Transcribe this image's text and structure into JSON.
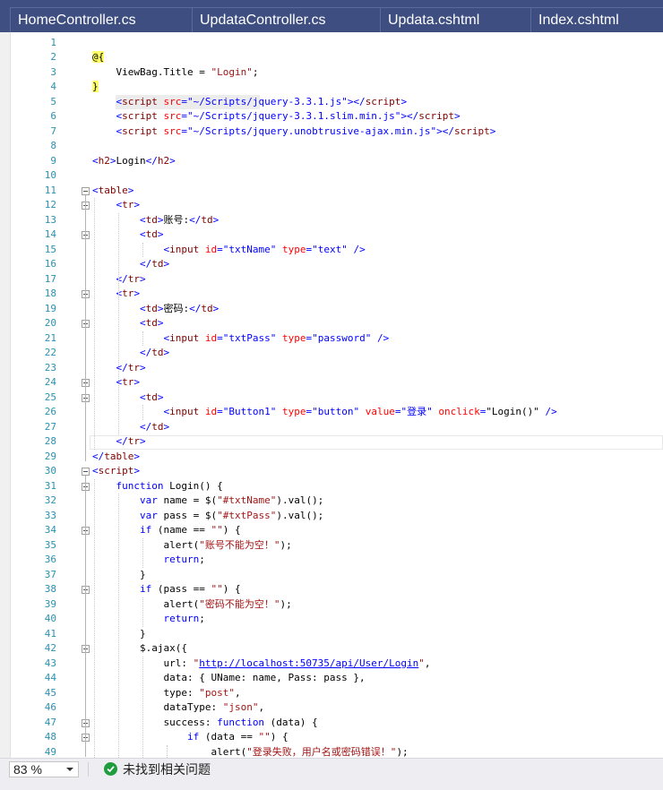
{
  "tabs": [
    {
      "label": "HomeController.cs"
    },
    {
      "label": "UpdataController.cs"
    },
    {
      "label": "Updata.cshtml"
    },
    {
      "label": "Index.cshtml"
    }
  ],
  "editor": {
    "current_line": 26,
    "lines": [
      {
        "n": "1",
        "segs": []
      },
      {
        "n": "2",
        "segs": [
          [
            "r",
            "@{"
          ]
        ]
      },
      {
        "n": "3",
        "segs": [
          [
            "p",
            "    ViewBag.Title = "
          ],
          [
            "s",
            "\"Login\""
          ],
          [
            "p",
            ";"
          ]
        ]
      },
      {
        "n": "4",
        "segs": [
          [
            "r",
            "}"
          ]
        ]
      },
      {
        "n": "5",
        "segs": [
          [
            "p",
            "    "
          ],
          [
            "k",
            "<"
          ],
          [
            "t",
            "script"
          ],
          [
            "p",
            " "
          ],
          [
            "a",
            "src"
          ],
          [
            "k",
            "="
          ],
          [
            "k",
            "\"~/Scripts/jquery-3.3.1.js\""
          ],
          [
            "k",
            "></"
          ],
          [
            "t",
            "script"
          ],
          [
            "k",
            ">"
          ]
        ]
      },
      {
        "n": "6",
        "segs": [
          [
            "p",
            "    "
          ],
          [
            "k",
            "<"
          ],
          [
            "t",
            "script"
          ],
          [
            "p",
            " "
          ],
          [
            "a",
            "src"
          ],
          [
            "k",
            "="
          ],
          [
            "k",
            "\"~/Scripts/jquery-3.3.1.slim.min.js\""
          ],
          [
            "k",
            "></"
          ],
          [
            "t",
            "script"
          ],
          [
            "k",
            ">"
          ]
        ]
      },
      {
        "n": "7",
        "segs": [
          [
            "p",
            "    "
          ],
          [
            "k",
            "<"
          ],
          [
            "t",
            "script"
          ],
          [
            "p",
            " "
          ],
          [
            "a",
            "src"
          ],
          [
            "k",
            "="
          ],
          [
            "k",
            "\"~/Scripts/jquery.unobtrusive-ajax.min.js\""
          ],
          [
            "k",
            "></"
          ],
          [
            "t",
            "script"
          ],
          [
            "k",
            ">"
          ]
        ]
      },
      {
        "n": "8",
        "segs": []
      },
      {
        "n": "9",
        "segs": [
          [
            "k",
            "<"
          ],
          [
            "t",
            "h2"
          ],
          [
            "k",
            ">"
          ],
          [
            "p",
            "Login"
          ],
          [
            "k",
            "</"
          ],
          [
            "t",
            "h2"
          ],
          [
            "k",
            ">"
          ]
        ]
      },
      {
        "n": "10",
        "segs": []
      },
      {
        "n": "11",
        "segs": [
          [
            "k",
            "<"
          ],
          [
            "t",
            "table"
          ],
          [
            "k",
            ">"
          ]
        ]
      },
      {
        "n": "12",
        "segs": [
          [
            "p",
            "    "
          ],
          [
            "k",
            "<"
          ],
          [
            "t",
            "tr"
          ],
          [
            "k",
            ">"
          ]
        ]
      },
      {
        "n": "13",
        "segs": [
          [
            "p",
            "        "
          ],
          [
            "k",
            "<"
          ],
          [
            "t",
            "td"
          ],
          [
            "k",
            ">"
          ],
          [
            "p",
            "账号:"
          ],
          [
            "k",
            "</"
          ],
          [
            "t",
            "td"
          ],
          [
            "k",
            ">"
          ]
        ]
      },
      {
        "n": "14",
        "segs": [
          [
            "p",
            "        "
          ],
          [
            "k",
            "<"
          ],
          [
            "t",
            "td"
          ],
          [
            "k",
            ">"
          ]
        ]
      },
      {
        "n": "15",
        "segs": [
          [
            "p",
            "            "
          ],
          [
            "k",
            "<"
          ],
          [
            "t",
            "input"
          ],
          [
            "p",
            " "
          ],
          [
            "a",
            "id"
          ],
          [
            "k",
            "="
          ],
          [
            "k",
            "\"txtName\""
          ],
          [
            "p",
            " "
          ],
          [
            "a",
            "type"
          ],
          [
            "k",
            "="
          ],
          [
            "k",
            "\"text\""
          ],
          [
            "p",
            " "
          ],
          [
            "k",
            "/>"
          ]
        ]
      },
      {
        "n": "16",
        "segs": [
          [
            "p",
            "        "
          ],
          [
            "k",
            "</"
          ],
          [
            "t",
            "td"
          ],
          [
            "k",
            ">"
          ]
        ]
      },
      {
        "n": "17",
        "segs": [
          [
            "p",
            "    "
          ],
          [
            "k",
            "</"
          ],
          [
            "t",
            "tr"
          ],
          [
            "k",
            ">"
          ]
        ]
      },
      {
        "n": "18",
        "segs": [
          [
            "p",
            "    "
          ],
          [
            "k",
            "<"
          ],
          [
            "t",
            "tr"
          ],
          [
            "k",
            ">"
          ]
        ]
      },
      {
        "n": "19",
        "segs": [
          [
            "p",
            "        "
          ],
          [
            "k",
            "<"
          ],
          [
            "t",
            "td"
          ],
          [
            "k",
            ">"
          ],
          [
            "p",
            "密码:"
          ],
          [
            "k",
            "</"
          ],
          [
            "t",
            "td"
          ],
          [
            "k",
            ">"
          ]
        ]
      },
      {
        "n": "20",
        "segs": [
          [
            "p",
            "        "
          ],
          [
            "k",
            "<"
          ],
          [
            "t",
            "td"
          ],
          [
            "k",
            ">"
          ]
        ]
      },
      {
        "n": "21",
        "segs": [
          [
            "p",
            "            "
          ],
          [
            "k",
            "<"
          ],
          [
            "t",
            "input"
          ],
          [
            "p",
            " "
          ],
          [
            "a",
            "id"
          ],
          [
            "k",
            "="
          ],
          [
            "k",
            "\"txtPass\""
          ],
          [
            "p",
            " "
          ],
          [
            "a",
            "type"
          ],
          [
            "k",
            "="
          ],
          [
            "k",
            "\"password\""
          ],
          [
            "p",
            " "
          ],
          [
            "k",
            "/>"
          ]
        ]
      },
      {
        "n": "22",
        "segs": [
          [
            "p",
            "        "
          ],
          [
            "k",
            "</"
          ],
          [
            "t",
            "td"
          ],
          [
            "k",
            ">"
          ]
        ]
      },
      {
        "n": "23",
        "segs": [
          [
            "p",
            "    "
          ],
          [
            "k",
            "</"
          ],
          [
            "t",
            "tr"
          ],
          [
            "k",
            ">"
          ]
        ]
      },
      {
        "n": "24",
        "segs": [
          [
            "p",
            "    "
          ],
          [
            "k",
            "<"
          ],
          [
            "t",
            "tr"
          ],
          [
            "k",
            ">"
          ]
        ]
      },
      {
        "n": "25",
        "segs": [
          [
            "p",
            "        "
          ],
          [
            "k",
            "<"
          ],
          [
            "t",
            "td"
          ],
          [
            "k",
            ">"
          ]
        ]
      },
      {
        "n": "26",
        "segs": [
          [
            "p",
            "            "
          ],
          [
            "k",
            "<"
          ],
          [
            "t",
            "input"
          ],
          [
            "p",
            " "
          ],
          [
            "a",
            "id"
          ],
          [
            "k",
            "="
          ],
          [
            "k",
            "\"Button1\""
          ],
          [
            "p",
            " "
          ],
          [
            "a",
            "type"
          ],
          [
            "k",
            "="
          ],
          [
            "k",
            "\"button\""
          ],
          [
            "p",
            " "
          ],
          [
            "a",
            "value"
          ],
          [
            "k",
            "="
          ],
          [
            "k",
            "\"登录\""
          ],
          [
            "p",
            " "
          ],
          [
            "a",
            "onclick"
          ],
          [
            "k",
            "="
          ],
          [
            "p",
            "\"Login()\""
          ],
          [
            "p",
            " "
          ],
          [
            "k",
            "/>"
          ]
        ]
      },
      {
        "n": "27",
        "segs": [
          [
            "p",
            "        "
          ],
          [
            "k",
            "</"
          ],
          [
            "t",
            "td"
          ],
          [
            "k",
            ">"
          ]
        ]
      },
      {
        "n": "28",
        "segs": [
          [
            "p",
            "    "
          ],
          [
            "k",
            "</"
          ],
          [
            "t",
            "tr"
          ],
          [
            "k",
            ">"
          ]
        ]
      },
      {
        "n": "29",
        "segs": [
          [
            "k",
            "</"
          ],
          [
            "t",
            "table"
          ],
          [
            "k",
            ">"
          ]
        ]
      },
      {
        "n": "30",
        "segs": [
          [
            "k",
            "<"
          ],
          [
            "t",
            "script"
          ],
          [
            "k",
            ">"
          ]
        ]
      },
      {
        "n": "31",
        "segs": [
          [
            "p",
            "    "
          ],
          [
            "k",
            "function"
          ],
          [
            "p",
            " Login() {"
          ]
        ]
      },
      {
        "n": "32",
        "segs": [
          [
            "p",
            "        "
          ],
          [
            "k",
            "var"
          ],
          [
            "p",
            " name = $("
          ],
          [
            "s",
            "\"#txtName\""
          ],
          [
            "p",
            ").val();"
          ]
        ]
      },
      {
        "n": "33",
        "segs": [
          [
            "p",
            "        "
          ],
          [
            "k",
            "var"
          ],
          [
            "p",
            " pass = $("
          ],
          [
            "s",
            "\"#txtPass\""
          ],
          [
            "p",
            ").val();"
          ]
        ]
      },
      {
        "n": "34",
        "segs": [
          [
            "p",
            "        "
          ],
          [
            "k",
            "if"
          ],
          [
            "p",
            " (name == "
          ],
          [
            "s",
            "\"\""
          ],
          [
            "p",
            ") {"
          ]
        ]
      },
      {
        "n": "35",
        "segs": [
          [
            "p",
            "            alert("
          ],
          [
            "s",
            "\"账号不能为空！\""
          ],
          [
            "p",
            ");"
          ]
        ]
      },
      {
        "n": "36",
        "segs": [
          [
            "p",
            "            "
          ],
          [
            "k",
            "return"
          ],
          [
            "p",
            ";"
          ]
        ]
      },
      {
        "n": "37",
        "segs": [
          [
            "p",
            "        }"
          ]
        ]
      },
      {
        "n": "38",
        "segs": [
          [
            "p",
            "        "
          ],
          [
            "k",
            "if"
          ],
          [
            "p",
            " (pass == "
          ],
          [
            "s",
            "\"\""
          ],
          [
            "p",
            ") {"
          ]
        ]
      },
      {
        "n": "39",
        "segs": [
          [
            "p",
            "            alert("
          ],
          [
            "s",
            "\"密码不能为空！\""
          ],
          [
            "p",
            ");"
          ]
        ]
      },
      {
        "n": "40",
        "segs": [
          [
            "p",
            "            "
          ],
          [
            "k",
            "return"
          ],
          [
            "p",
            ";"
          ]
        ]
      },
      {
        "n": "41",
        "segs": [
          [
            "p",
            "        }"
          ]
        ]
      },
      {
        "n": "42",
        "segs": [
          [
            "p",
            "        $.ajax({"
          ]
        ]
      },
      {
        "n": "43",
        "segs": [
          [
            "p",
            "            url: "
          ],
          [
            "s",
            "\""
          ],
          [
            "u",
            "http://localhost:50735/api/User/Login"
          ],
          [
            "s",
            "\""
          ],
          [
            "p",
            ","
          ]
        ]
      },
      {
        "n": "44",
        "segs": [
          [
            "p",
            "            data: { UName: name, Pass: pass },"
          ]
        ]
      },
      {
        "n": "45",
        "segs": [
          [
            "p",
            "            type: "
          ],
          [
            "s",
            "\"post\""
          ],
          [
            "p",
            ","
          ]
        ]
      },
      {
        "n": "46",
        "segs": [
          [
            "p",
            "            dataType: "
          ],
          [
            "s",
            "\"json\""
          ],
          [
            "p",
            ","
          ]
        ]
      },
      {
        "n": "47",
        "segs": [
          [
            "p",
            "            success: "
          ],
          [
            "k",
            "function"
          ],
          [
            "p",
            " (data) {"
          ]
        ]
      },
      {
        "n": "48",
        "segs": [
          [
            "p",
            "                "
          ],
          [
            "k",
            "if"
          ],
          [
            "p",
            " (data == "
          ],
          [
            "s",
            "\"\""
          ],
          [
            "p",
            ") {"
          ]
        ]
      },
      {
        "n": "49",
        "segs": [
          [
            "p",
            "                    alert("
          ],
          [
            "s",
            "\"登录失败，用户名或密码错误！\""
          ],
          [
            "p",
            ");"
          ]
        ]
      }
    ]
  },
  "status_bar": {
    "zoom": "83 %",
    "message": "未找到相关问题",
    "status_color": "#1f9c3d"
  },
  "colors": {
    "tab_bar": "#3f4f82",
    "line_number": "#2b91af",
    "keyword": "#0000ff",
    "tag": "#800000",
    "attribute": "#ff0000",
    "string": "#a31515",
    "razor_highlight": "#ffff66"
  }
}
